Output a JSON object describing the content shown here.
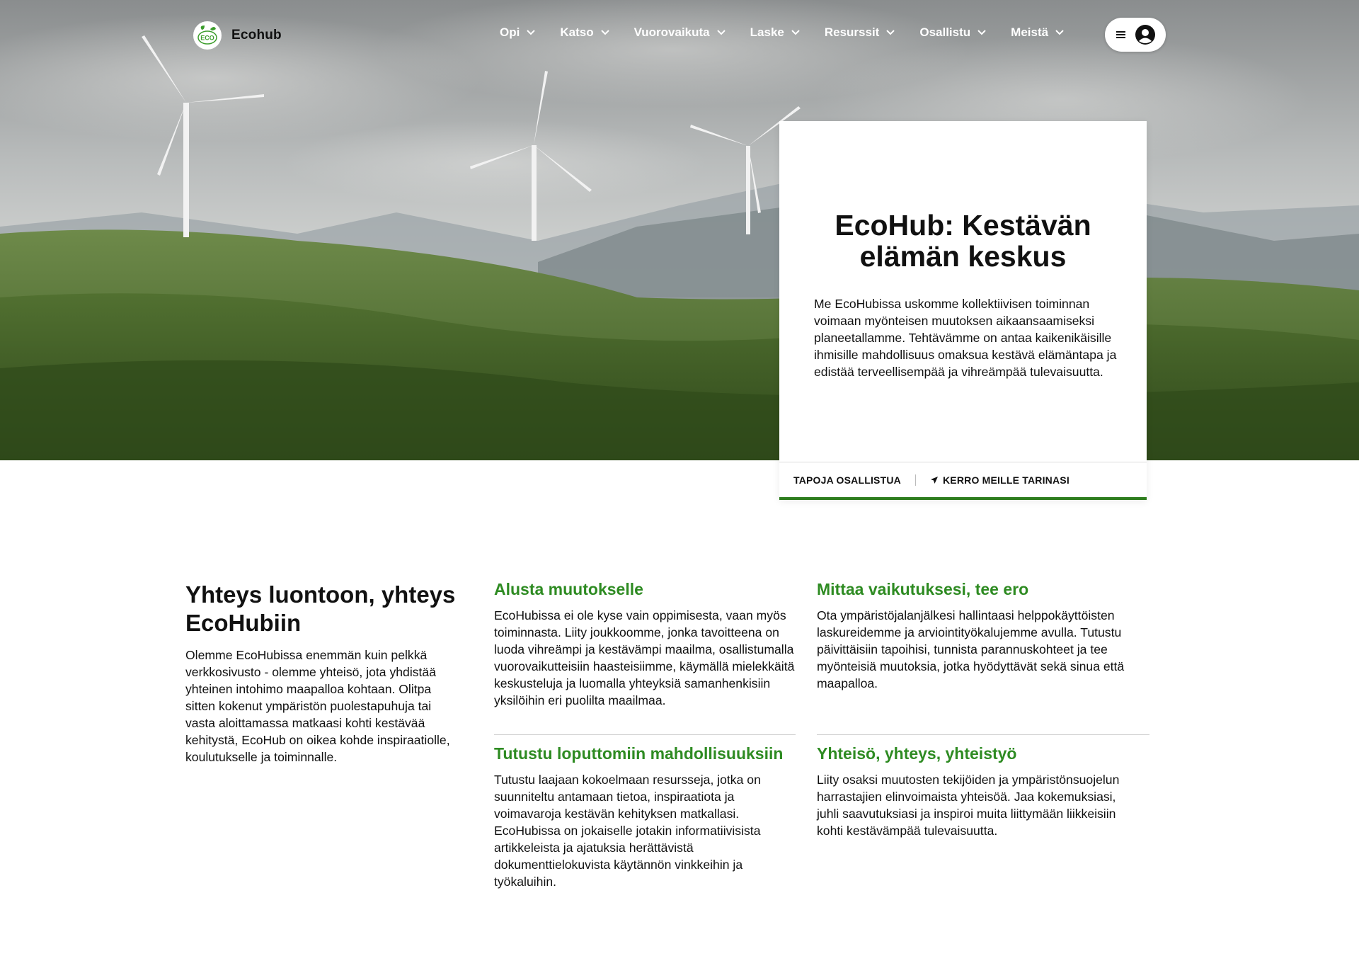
{
  "header": {
    "logo_badge": "ECO",
    "logo_text": "Ecohub",
    "nav": [
      "Opi",
      "Katso",
      "Vuorovaikuta",
      "Laske",
      "Resurssit",
      "Osallistu",
      "Meistä"
    ]
  },
  "hero_card": {
    "title": "EcoHub: Kestävän elämän keskus",
    "text": "Me EcoHubissa uskomme kollektiivisen toiminnan voimaan myönteisen muutoksen aikaansaamiseksi planeetallamme. Tehtävämme on antaa kaikenikäisille ihmisille mahdollisuus omaksua kestävä elämäntapa ja edistää terveellisempää ja vihreämpää tulevaisuutta.",
    "link_1": "TAPOJA OSALLISTUA",
    "link_2": "KERRO MEILLE TARINASI"
  },
  "intro": {
    "title": "Yhteys luontoon, yhteys EcoHubiin",
    "text": "Olemme EcoHubissa enemmän kuin pelkkä verkkosivusto - olemme yhteisö, jota yhdistää yhteinen intohimo maapalloa kohtaan. Olitpa sitten kokenut ympäristön puolestapuhuja tai vasta aloittamassa matkaasi kohti kestävää kehitystä, EcoHub on oikea kohde inspiraatiolle, koulutukselle ja toiminnalle."
  },
  "features": [
    {
      "title": "Alusta muutokselle",
      "text": "EcoHubissa ei ole kyse vain oppimisesta, vaan myös toiminnasta. Liity joukkoomme, jonka tavoitteena on luoda vihreämpi ja kestävämpi maailma, osallistumalla vuorovaikutteisiin haasteisiimme, käymällä mielekkäitä keskusteluja ja luomalla yhteyksiä samanhenkisiin yksilöihin eri puolilta maailmaa."
    },
    {
      "title": "Mittaa vaikutuksesi, tee ero",
      "text": "Ota ympäristöjalanjälkesi hallintaasi helppokäyttöisten laskureidemme ja arviointityökalujemme avulla. Tutustu päivittäisiin tapoihisi, tunnista parannuskohteet ja tee myönteisiä muutoksia, jotka hyödyttävät sekä sinua että maapalloa."
    },
    {
      "title": "Tutustu loputtomiin mahdollisuuksiin",
      "text": "Tutustu laajaan kokoelmaan resursseja, jotka on suunniteltu antamaan tietoa, inspiraatiota ja voimavaroja kestävän kehityksen matkallasi. EcoHubissa on jokaiselle jotakin informatiivisista artikkeleista ja ajatuksia herättävistä dokumenttielokuvista käytännön vinkkeihin ja työkaluihin."
    },
    {
      "title": "Yhteisö, yhteys, yhteistyö",
      "text": "Liity osaksi muutosten tekijöiden ja ympäristönsuojelun harrastajien elinvoimaista yhteisöä. Jaa kokemuksiasi, juhli saavutuksiasi ja inspiroi muita liittymään liikkeisiin kohti kestävämpää tulevaisuutta."
    }
  ],
  "colors": {
    "accent_green": "#2e8b22",
    "bar_green": "#2e7d1e"
  },
  "icons": [
    "eco-logo-icon",
    "chevron-down-icon",
    "menu-icon",
    "user-icon",
    "send-arrow-icon"
  ]
}
